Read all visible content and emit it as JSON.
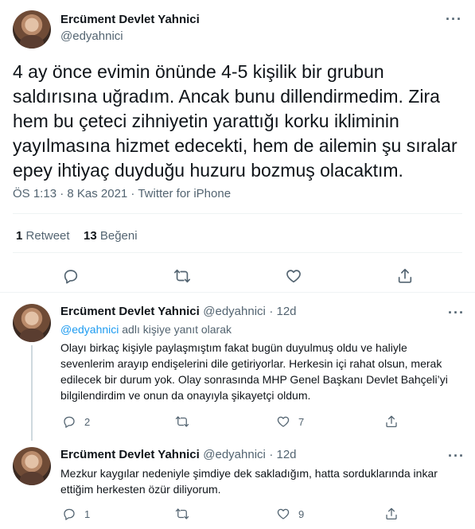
{
  "tweet": {
    "author_name": "Ercüment Devlet Yahnici",
    "author_handle": "@edyahnici",
    "more_label": "···",
    "text": "4 ay önce evimin önünde 4-5 kişilik bir grubun saldırısına uğradım. Ancak bunu dillendirmedim. Zira hem bu çeteci zihniyetin yarattığı korku ikliminin yayılmasına hizmet edecekti, hem de ailemin şu sıralar epey ihtiyaç duyduğu huzuru bozmuş olacaktım.",
    "timestamp": "ÖS 1:13 · 8 Kas 2021 · Twitter for iPhone",
    "retweet_count": "1",
    "retweet_label": "Retweet",
    "like_count": "13",
    "like_label": "Beğeni",
    "actions": [
      "reply-icon",
      "retweet-icon",
      "like-icon",
      "share-icon"
    ]
  },
  "replies": [
    {
      "author_name": "Ercüment Devlet Yahnici",
      "author_handle": "@edyahnici",
      "time": "· 12d",
      "replying_handle": "@edyahnici",
      "replying_suffix": "adlı kişiye yanıt olarak",
      "text": "Olayı birkaç kişiyle paylaşmıştım fakat bugün duyulmuş oldu ve haliyle sevenlerim arayıp endişelerini dile getiriyorlar. Herkesin içi rahat olsun, merak edilecek bir durum yok. Olay sonrasında MHP Genel Başkanı Devlet Bahçeli’yi bilgilendirdim ve onun da onayıyla şikayetçi oldum.",
      "reply_count": "2",
      "retweet_count": "",
      "like_count": "7"
    },
    {
      "author_name": "Ercüment Devlet Yahnici",
      "author_handle": "@edyahnici",
      "time": "· 12d",
      "text": "Mezkur kaygılar nedeniyle şimdiye dek sakladığım, hatta sorduklarında inkar ettiğim herkesten özür diliyorum.",
      "reply_count": "1",
      "retweet_count": "",
      "like_count": "9"
    }
  ]
}
